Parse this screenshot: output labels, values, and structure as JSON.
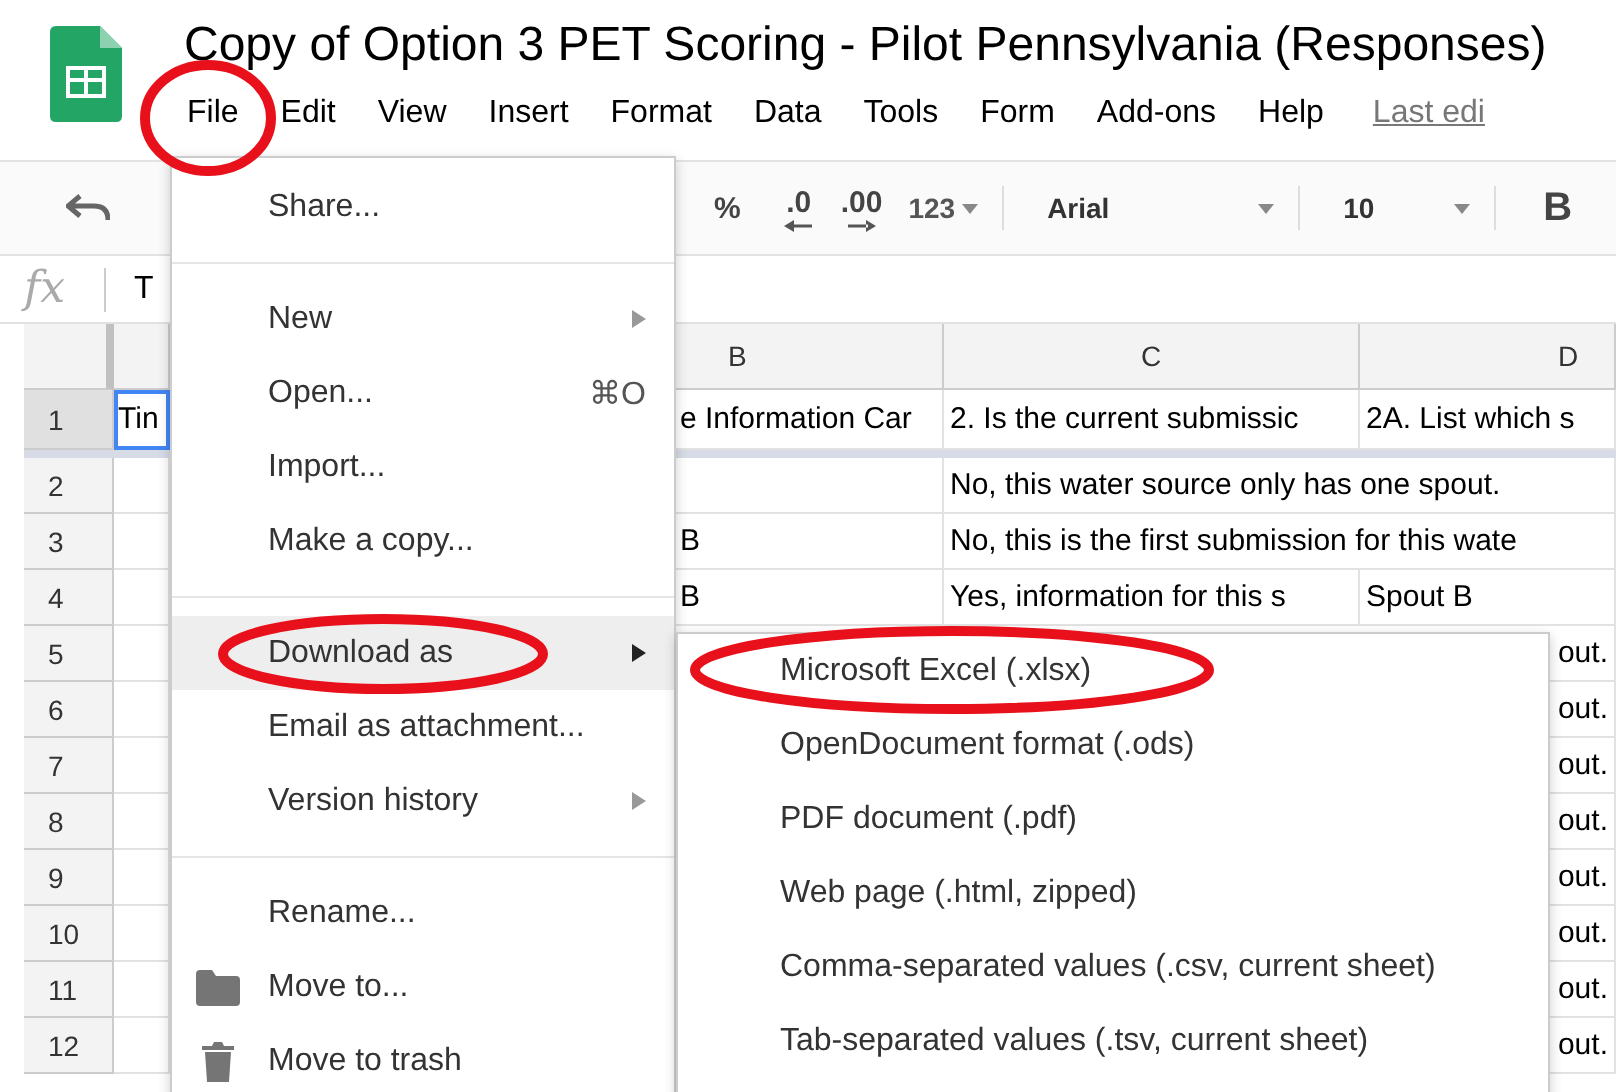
{
  "window": {
    "title": "Copy of Option 3 PET Scoring - Pilot Pennsylvania (Responses)"
  },
  "menu_bar": {
    "items": [
      {
        "label": "File",
        "circled": true
      },
      {
        "label": "Edit",
        "circled": false
      },
      {
        "label": "View",
        "circled": false
      },
      {
        "label": "Insert",
        "circled": false
      },
      {
        "label": "Format",
        "circled": false
      },
      {
        "label": "Data",
        "circled": false
      },
      {
        "label": "Tools",
        "circled": false
      },
      {
        "label": "Form",
        "circled": false
      },
      {
        "label": "Add-ons",
        "circled": false
      },
      {
        "label": "Help",
        "circled": false
      }
    ],
    "last_edit": "Last edi"
  },
  "toolbar": {
    "percent": "%",
    "decrease_decimals": ".0",
    "increase_decimals": ".00",
    "number_format": "123",
    "font": "Arial",
    "font_size": "10",
    "bold": "B"
  },
  "formula_bar": {
    "label": "fx",
    "value": "T"
  },
  "grid": {
    "columns": [
      "",
      "B",
      "C",
      "D"
    ],
    "rows": [
      {
        "number": "1",
        "cells": [
          {
            "text": "Tin",
            "selected": true
          },
          {
            "text": "e Information Car",
            "selected": false
          },
          {
            "text": "2. Is the current submissic",
            "selected": false
          },
          {
            "text": "2A. List which s",
            "selected": false
          }
        ]
      },
      {
        "number": "2",
        "cells": [
          {
            "text": "",
            "selected": false
          },
          {
            "text": "",
            "selected": false
          },
          {
            "text": "No, this water source only has one spout.",
            "selected": false
          }
        ]
      },
      {
        "number": "3",
        "cells": [
          {
            "text": "",
            "selected": false
          },
          {
            "text": "B",
            "selected": false
          },
          {
            "text": "No, this is the first submission for this wate",
            "selected": false
          }
        ]
      },
      {
        "number": "4",
        "cells": [
          {
            "text": "",
            "selected": false
          },
          {
            "text": "B",
            "selected": false
          },
          {
            "text": "Yes, information for this s",
            "selected": false
          },
          {
            "text": "Spout B",
            "selected": false
          }
        ]
      },
      {
        "number": "5",
        "cells": [
          {
            "text": "",
            "selected": false
          },
          {
            "text": "out.",
            "kind": "overflow",
            "selected": false
          }
        ]
      },
      {
        "number": "6",
        "cells": [
          {
            "text": "",
            "selected": false
          },
          {
            "text": "out.",
            "kind": "overflow",
            "selected": false
          }
        ]
      },
      {
        "number": "7",
        "cells": [
          {
            "text": "",
            "selected": false
          },
          {
            "text": "out.",
            "kind": "overflow",
            "selected": false
          }
        ]
      },
      {
        "number": "8",
        "cells": [
          {
            "text": "",
            "selected": false
          },
          {
            "text": "out.",
            "kind": "overflow",
            "selected": false
          }
        ]
      },
      {
        "number": "9",
        "cells": [
          {
            "text": "",
            "selected": false
          },
          {
            "text": "out.",
            "kind": "overflow",
            "selected": false
          }
        ]
      },
      {
        "number": "10",
        "cells": [
          {
            "text": "",
            "selected": false
          },
          {
            "text": "out.",
            "kind": "overflow",
            "selected": false
          }
        ]
      },
      {
        "number": "11",
        "cells": [
          {
            "text": "",
            "selected": false
          },
          {
            "text": "out.",
            "kind": "overflow",
            "selected": false
          }
        ]
      },
      {
        "number": "12",
        "cells": [
          {
            "text": "",
            "selected": false
          },
          {
            "text": "out.",
            "kind": "overflow",
            "selected": false
          }
        ]
      }
    ]
  },
  "file_menu": {
    "items": [
      {
        "label": "Share...",
        "selected": false,
        "circled": false,
        "has_submenu": false,
        "separator_after": true
      },
      {
        "label": "New",
        "selected": false,
        "circled": false,
        "has_submenu": true,
        "separator_after": false
      },
      {
        "label": "Open...",
        "shortcut": "⌘O",
        "selected": false,
        "circled": false,
        "has_submenu": false,
        "separator_after": false
      },
      {
        "label": "Import...",
        "selected": false,
        "circled": false,
        "has_submenu": false,
        "separator_after": false
      },
      {
        "label": "Make a copy...",
        "selected": false,
        "circled": false,
        "has_submenu": false,
        "separator_after": true
      },
      {
        "label": "Download as",
        "selected": true,
        "circled": true,
        "has_submenu": true,
        "separator_after": false
      },
      {
        "label": "Email as attachment...",
        "selected": false,
        "circled": false,
        "has_submenu": false,
        "separator_after": false
      },
      {
        "label": "Version history",
        "selected": false,
        "circled": false,
        "has_submenu": true,
        "separator_after": true
      },
      {
        "label": "Rename...",
        "selected": false,
        "circled": false,
        "has_submenu": false,
        "separator_after": false
      },
      {
        "label": "Move to...",
        "kind": "folder",
        "selected": false,
        "circled": false,
        "has_submenu": false,
        "separator_after": false
      },
      {
        "label": "Move to trash",
        "kind": "trash",
        "selected": false,
        "circled": false,
        "has_submenu": false,
        "separator_after": false
      }
    ]
  },
  "download_submenu": {
    "items": [
      {
        "label": "Microsoft Excel (.xlsx)",
        "circled": true
      },
      {
        "label": "OpenDocument format (.ods)",
        "circled": false
      },
      {
        "label": "PDF document (.pdf)",
        "circled": false
      },
      {
        "label": "Web page (.html, zipped)",
        "circled": false
      },
      {
        "label": "Comma-separated values (.csv, current sheet)",
        "circled": false
      },
      {
        "label": "Tab-separated values (.tsv, current sheet)",
        "circled": false
      }
    ]
  }
}
